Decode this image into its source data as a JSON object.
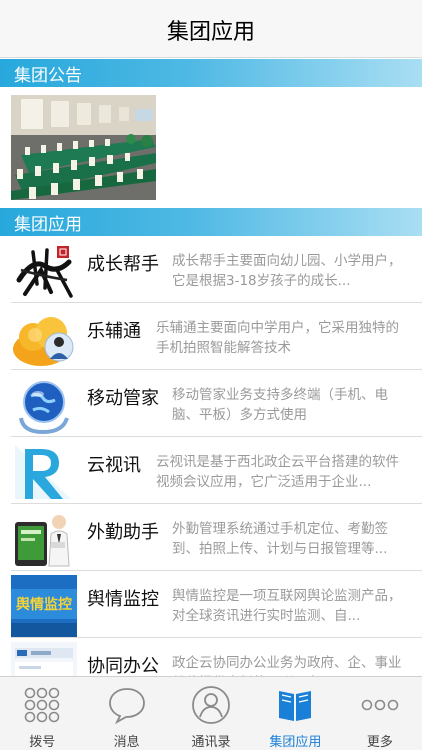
{
  "header": {
    "title": "集团应用"
  },
  "sections": {
    "notice_title": "集团公告",
    "apps_title": "集团应用"
  },
  "apps": [
    {
      "name": "成长帮手",
      "desc": "成长帮手主要面向幼儿园、小学用户，它是根据3-18岁孩子的成长...",
      "icon": "calligraphy-icon"
    },
    {
      "name": "乐辅通",
      "desc": "乐辅通主要面向中学用户，它采用独特的手机拍照智能解答技术",
      "icon": "cloud-user-icon"
    },
    {
      "name": "移动管家",
      "desc": "移动管家业务支持多终端（手机、电脑、平板）多方式使用",
      "icon": "globe-hands-icon"
    },
    {
      "name": "云视讯",
      "desc": "云视讯是基于西北政企云平台搭建的软件视频会议应用，它广泛适用于企业...",
      "icon": "video-r-icon"
    },
    {
      "name": "外勤助手",
      "desc": "外勤管理系统通过手机定位、考勤签到、拍照上传、计划与日报管理等...",
      "icon": "field-assistant-icon"
    },
    {
      "name": "舆情监控",
      "desc": "舆情监控是一项互联网舆论监测产品，对全球资讯进行实时监测、自...",
      "icon": "opinion-monitor-icon",
      "icon_text": "舆情监控"
    },
    {
      "name": "协同办公",
      "desc": "政企云协同办公业务为政府、企、事业单位提供全新的互联网办公...",
      "icon": "collab-office-icon"
    }
  ],
  "tabs": [
    {
      "label": "拨号",
      "icon": "dialpad-icon"
    },
    {
      "label": "消息",
      "icon": "chat-bubble-icon"
    },
    {
      "label": "通讯录",
      "icon": "contact-icon"
    },
    {
      "label": "集团应用",
      "icon": "book-icon",
      "active": true
    },
    {
      "label": "更多",
      "icon": "more-dots-icon"
    }
  ],
  "colors": {
    "accent": "#1a7fd6",
    "section_start": "#27a8dc",
    "section_end": "#a9def3"
  }
}
